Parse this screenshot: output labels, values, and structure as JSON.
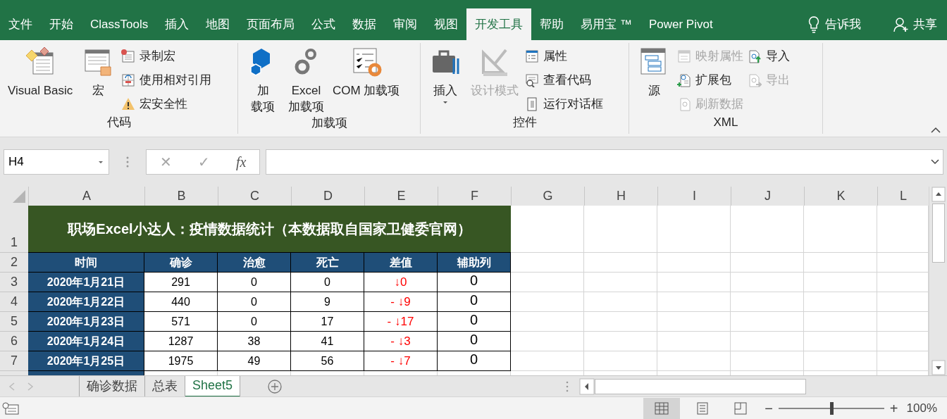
{
  "ribbon_tabs": [
    {
      "label": "文件",
      "selected": false
    },
    {
      "label": "开始",
      "selected": false
    },
    {
      "label": "ClassTools",
      "selected": false
    },
    {
      "label": "插入",
      "selected": false
    },
    {
      "label": "地图",
      "selected": false
    },
    {
      "label": "页面布局",
      "selected": false
    },
    {
      "label": "公式",
      "selected": false
    },
    {
      "label": "数据",
      "selected": false
    },
    {
      "label": "审阅",
      "selected": false
    },
    {
      "label": "视图",
      "selected": false
    },
    {
      "label": "开发工具",
      "selected": true
    },
    {
      "label": "帮助",
      "selected": false
    },
    {
      "label": "易用宝 ™",
      "selected": false
    },
    {
      "label": "Power Pivot",
      "selected": false
    }
  ],
  "tell_me": "告诉我",
  "share": "共享",
  "ribbon_groups": [
    {
      "label": "代码",
      "items": [
        {
          "kind": "large",
          "lines": [
            "Visual Basic"
          ],
          "disabled": false
        },
        {
          "kind": "large",
          "lines": [
            "宏"
          ],
          "disabled": false
        },
        {
          "kind": "small",
          "label": "录制宏",
          "disabled": false
        },
        {
          "kind": "small",
          "label": "使用相对引用",
          "disabled": false
        },
        {
          "kind": "small",
          "label": "宏安全性",
          "disabled": false
        }
      ]
    },
    {
      "label": "加载项",
      "items": [
        {
          "kind": "large",
          "lines": [
            "加",
            "载项"
          ],
          "disabled": false
        },
        {
          "kind": "large",
          "lines": [
            "Excel",
            "加载项"
          ],
          "disabled": false
        },
        {
          "kind": "large",
          "lines": [
            "COM 加载项"
          ],
          "disabled": false
        }
      ]
    },
    {
      "label": "控件",
      "items": [
        {
          "kind": "large",
          "lines": [
            "插入"
          ],
          "disabled": false,
          "dropdown": true
        },
        {
          "kind": "large",
          "lines": [
            "设计模式"
          ],
          "disabled": true
        },
        {
          "kind": "small",
          "label": "属性",
          "disabled": false
        },
        {
          "kind": "small",
          "label": "查看代码",
          "disabled": false
        },
        {
          "kind": "small",
          "label": "运行对话框",
          "disabled": false
        }
      ]
    },
    {
      "label": "XML",
      "items": [
        {
          "kind": "large",
          "lines": [
            "源"
          ],
          "disabled": false
        },
        {
          "kind": "small",
          "label": "映射属性",
          "disabled": true
        },
        {
          "kind": "small",
          "label": "扩展包",
          "disabled": false
        },
        {
          "kind": "small",
          "label": "刷新数据",
          "disabled": true
        },
        {
          "kind": "small",
          "label": "导入",
          "disabled": false
        },
        {
          "kind": "small",
          "label": "导出",
          "disabled": true
        }
      ]
    }
  ],
  "name_box": "H4",
  "formula_buttons": [
    "✕",
    "✓",
    "fx"
  ],
  "columns": [
    "A",
    "B",
    "C",
    "D",
    "E",
    "F",
    "G",
    "H",
    "I",
    "J",
    "K",
    "L"
  ],
  "sheet": {
    "title": "职场Excel小达人：疫情数据统计（本数据取自国家卫健委官网）",
    "headers": [
      "时间",
      "确诊",
      "治愈",
      "死亡",
      "差值",
      "辅助列"
    ],
    "rows": [
      {
        "number": "3",
        "cells": [
          "2020年1月21日",
          "291",
          "0",
          "0",
          "↓0",
          "0"
        ]
      },
      {
        "number": "4",
        "cells": [
          "2020年1月22日",
          "440",
          "0",
          "9",
          "- ↓9",
          "0"
        ]
      },
      {
        "number": "5",
        "cells": [
          "2020年1月23日",
          "571",
          "0",
          "17",
          "- ↓17",
          "0"
        ]
      },
      {
        "number": "6",
        "cells": [
          "2020年1月24日",
          "1287",
          "38",
          "41",
          "- ↓3",
          "0"
        ]
      },
      {
        "number": "7",
        "cells": [
          "2020年1月25日",
          "1975",
          "49",
          "56",
          "- ↓7",
          "0"
        ]
      }
    ]
  },
  "title_row_number": "1",
  "header_row_number": "2",
  "sheet_tabs": [
    {
      "label": "确诊数据",
      "selected": false
    },
    {
      "label": "总表",
      "selected": false
    },
    {
      "label": "Sheet5",
      "selected": true
    }
  ],
  "zoom": {
    "out": "−",
    "in": "+",
    "label": "100%",
    "level": 0.5
  }
}
